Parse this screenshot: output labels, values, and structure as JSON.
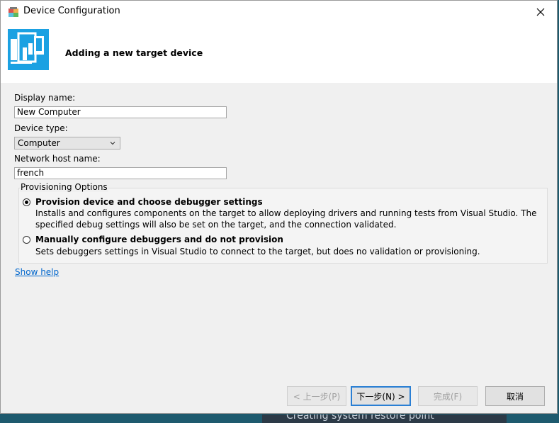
{
  "window": {
    "title": "Device Configuration"
  },
  "header": {
    "title": "Adding a new target device"
  },
  "form": {
    "display_name_label": "Display name:",
    "display_name_value": "New Computer",
    "device_type_label": "Device type:",
    "device_type_value": "Computer",
    "host_name_label": "Network host name:",
    "host_name_value": "french"
  },
  "provisioning": {
    "group_label": "Provisioning Options",
    "options": [
      {
        "title": "Provision device and choose debugger settings",
        "desc_line1": "Installs and configures components on the target to allow deploying drivers and running tests from Visual Studio. The",
        "desc_line2": "specified debug settings will also be set on the target, and the connection validated.",
        "selected": true
      },
      {
        "title": "Manually configure debuggers and do not provision",
        "desc_line1": "Sets debuggers settings in Visual Studio to connect to the target, but does no validation or provisioning.",
        "selected": false
      }
    ]
  },
  "help_link": "Show help",
  "buttons": {
    "back": "< 上一步(P)",
    "next": "下一步(N) >",
    "finish": "完成(F)",
    "cancel": "取消"
  },
  "background": {
    "behind_text": "Creating system restore point"
  },
  "colors": {
    "accent": "#1ba1e2",
    "link": "#0066cc",
    "default_button_border": "#2a7fd4"
  }
}
